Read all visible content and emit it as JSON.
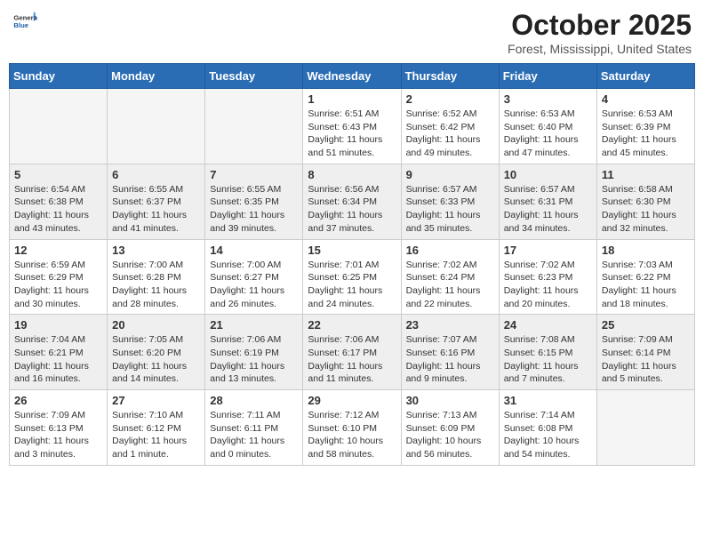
{
  "header": {
    "logo_general": "General",
    "logo_blue": "Blue",
    "month_title": "October 2025",
    "location": "Forest, Mississippi, United States"
  },
  "weekdays": [
    "Sunday",
    "Monday",
    "Tuesday",
    "Wednesday",
    "Thursday",
    "Friday",
    "Saturday"
  ],
  "weeks": [
    [
      {
        "day": "",
        "sunrise": "",
        "sunset": "",
        "daylight": ""
      },
      {
        "day": "",
        "sunrise": "",
        "sunset": "",
        "daylight": ""
      },
      {
        "day": "",
        "sunrise": "",
        "sunset": "",
        "daylight": ""
      },
      {
        "day": "1",
        "sunrise": "Sunrise: 6:51 AM",
        "sunset": "Sunset: 6:43 PM",
        "daylight": "Daylight: 11 hours and 51 minutes."
      },
      {
        "day": "2",
        "sunrise": "Sunrise: 6:52 AM",
        "sunset": "Sunset: 6:42 PM",
        "daylight": "Daylight: 11 hours and 49 minutes."
      },
      {
        "day": "3",
        "sunrise": "Sunrise: 6:53 AM",
        "sunset": "Sunset: 6:40 PM",
        "daylight": "Daylight: 11 hours and 47 minutes."
      },
      {
        "day": "4",
        "sunrise": "Sunrise: 6:53 AM",
        "sunset": "Sunset: 6:39 PM",
        "daylight": "Daylight: 11 hours and 45 minutes."
      }
    ],
    [
      {
        "day": "5",
        "sunrise": "Sunrise: 6:54 AM",
        "sunset": "Sunset: 6:38 PM",
        "daylight": "Daylight: 11 hours and 43 minutes."
      },
      {
        "day": "6",
        "sunrise": "Sunrise: 6:55 AM",
        "sunset": "Sunset: 6:37 PM",
        "daylight": "Daylight: 11 hours and 41 minutes."
      },
      {
        "day": "7",
        "sunrise": "Sunrise: 6:55 AM",
        "sunset": "Sunset: 6:35 PM",
        "daylight": "Daylight: 11 hours and 39 minutes."
      },
      {
        "day": "8",
        "sunrise": "Sunrise: 6:56 AM",
        "sunset": "Sunset: 6:34 PM",
        "daylight": "Daylight: 11 hours and 37 minutes."
      },
      {
        "day": "9",
        "sunrise": "Sunrise: 6:57 AM",
        "sunset": "Sunset: 6:33 PM",
        "daylight": "Daylight: 11 hours and 35 minutes."
      },
      {
        "day": "10",
        "sunrise": "Sunrise: 6:57 AM",
        "sunset": "Sunset: 6:31 PM",
        "daylight": "Daylight: 11 hours and 34 minutes."
      },
      {
        "day": "11",
        "sunrise": "Sunrise: 6:58 AM",
        "sunset": "Sunset: 6:30 PM",
        "daylight": "Daylight: 11 hours and 32 minutes."
      }
    ],
    [
      {
        "day": "12",
        "sunrise": "Sunrise: 6:59 AM",
        "sunset": "Sunset: 6:29 PM",
        "daylight": "Daylight: 11 hours and 30 minutes."
      },
      {
        "day": "13",
        "sunrise": "Sunrise: 7:00 AM",
        "sunset": "Sunset: 6:28 PM",
        "daylight": "Daylight: 11 hours and 28 minutes."
      },
      {
        "day": "14",
        "sunrise": "Sunrise: 7:00 AM",
        "sunset": "Sunset: 6:27 PM",
        "daylight": "Daylight: 11 hours and 26 minutes."
      },
      {
        "day": "15",
        "sunrise": "Sunrise: 7:01 AM",
        "sunset": "Sunset: 6:25 PM",
        "daylight": "Daylight: 11 hours and 24 minutes."
      },
      {
        "day": "16",
        "sunrise": "Sunrise: 7:02 AM",
        "sunset": "Sunset: 6:24 PM",
        "daylight": "Daylight: 11 hours and 22 minutes."
      },
      {
        "day": "17",
        "sunrise": "Sunrise: 7:02 AM",
        "sunset": "Sunset: 6:23 PM",
        "daylight": "Daylight: 11 hours and 20 minutes."
      },
      {
        "day": "18",
        "sunrise": "Sunrise: 7:03 AM",
        "sunset": "Sunset: 6:22 PM",
        "daylight": "Daylight: 11 hours and 18 minutes."
      }
    ],
    [
      {
        "day": "19",
        "sunrise": "Sunrise: 7:04 AM",
        "sunset": "Sunset: 6:21 PM",
        "daylight": "Daylight: 11 hours and 16 minutes."
      },
      {
        "day": "20",
        "sunrise": "Sunrise: 7:05 AM",
        "sunset": "Sunset: 6:20 PM",
        "daylight": "Daylight: 11 hours and 14 minutes."
      },
      {
        "day": "21",
        "sunrise": "Sunrise: 7:06 AM",
        "sunset": "Sunset: 6:19 PM",
        "daylight": "Daylight: 11 hours and 13 minutes."
      },
      {
        "day": "22",
        "sunrise": "Sunrise: 7:06 AM",
        "sunset": "Sunset: 6:17 PM",
        "daylight": "Daylight: 11 hours and 11 minutes."
      },
      {
        "day": "23",
        "sunrise": "Sunrise: 7:07 AM",
        "sunset": "Sunset: 6:16 PM",
        "daylight": "Daylight: 11 hours and 9 minutes."
      },
      {
        "day": "24",
        "sunrise": "Sunrise: 7:08 AM",
        "sunset": "Sunset: 6:15 PM",
        "daylight": "Daylight: 11 hours and 7 minutes."
      },
      {
        "day": "25",
        "sunrise": "Sunrise: 7:09 AM",
        "sunset": "Sunset: 6:14 PM",
        "daylight": "Daylight: 11 hours and 5 minutes."
      }
    ],
    [
      {
        "day": "26",
        "sunrise": "Sunrise: 7:09 AM",
        "sunset": "Sunset: 6:13 PM",
        "daylight": "Daylight: 11 hours and 3 minutes."
      },
      {
        "day": "27",
        "sunrise": "Sunrise: 7:10 AM",
        "sunset": "Sunset: 6:12 PM",
        "daylight": "Daylight: 11 hours and 1 minute."
      },
      {
        "day": "28",
        "sunrise": "Sunrise: 7:11 AM",
        "sunset": "Sunset: 6:11 PM",
        "daylight": "Daylight: 11 hours and 0 minutes."
      },
      {
        "day": "29",
        "sunrise": "Sunrise: 7:12 AM",
        "sunset": "Sunset: 6:10 PM",
        "daylight": "Daylight: 10 hours and 58 minutes."
      },
      {
        "day": "30",
        "sunrise": "Sunrise: 7:13 AM",
        "sunset": "Sunset: 6:09 PM",
        "daylight": "Daylight: 10 hours and 56 minutes."
      },
      {
        "day": "31",
        "sunrise": "Sunrise: 7:14 AM",
        "sunset": "Sunset: 6:08 PM",
        "daylight": "Daylight: 10 hours and 54 minutes."
      },
      {
        "day": "",
        "sunrise": "",
        "sunset": "",
        "daylight": ""
      }
    ]
  ]
}
